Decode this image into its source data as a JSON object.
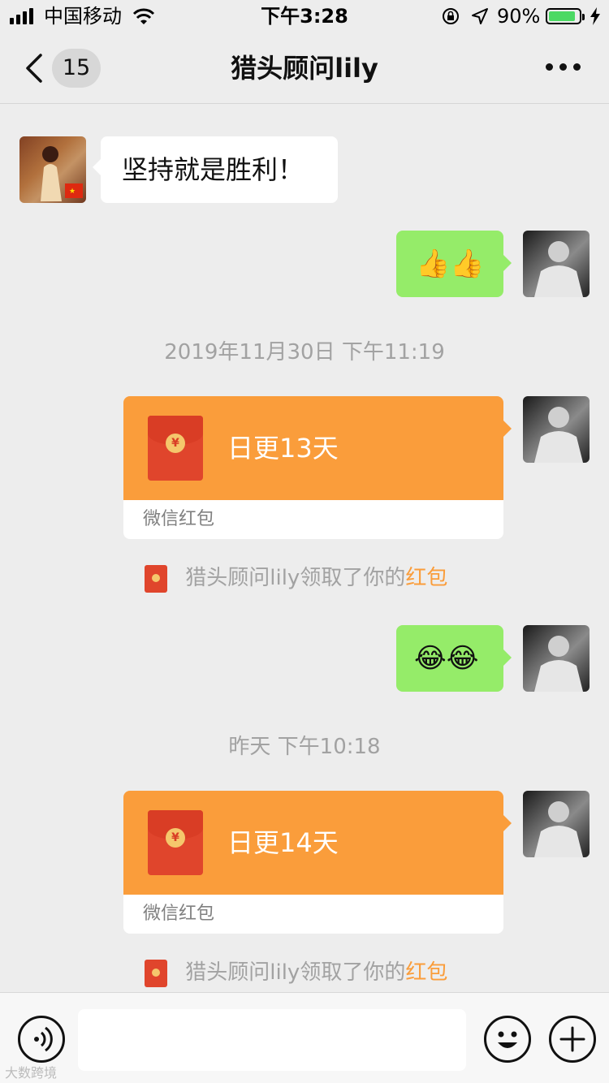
{
  "status_bar": {
    "carrier": "中国移动",
    "time": "下午3:28",
    "battery_percent": "90%",
    "battery_level": 0.9
  },
  "nav": {
    "unread_count": "15",
    "title": "猎头顾问lily"
  },
  "messages": {
    "m1_text": "坚持就是胜利！",
    "m2_emoji": "👍👍",
    "ts1": "2019年11月30日 下午11:19",
    "packet1_title": "日更13天",
    "packet1_label": "微信红包",
    "note1_prefix": "猎头顾问lily领取了你的",
    "note1_link": "红包",
    "m3_emoji": "😂😂",
    "ts2": "昨天 下午10:18",
    "packet2_title": "日更14天",
    "packet2_label": "微信红包",
    "note2_prefix": "猎头顾问lily领取了你的",
    "note2_link": "红包"
  },
  "watermark": "大数跨境",
  "colors": {
    "bg": "#ededed",
    "green_bubble": "#95ec69",
    "packet_orange": "#fa9d3b",
    "link_orange": "#fa9d3b"
  }
}
